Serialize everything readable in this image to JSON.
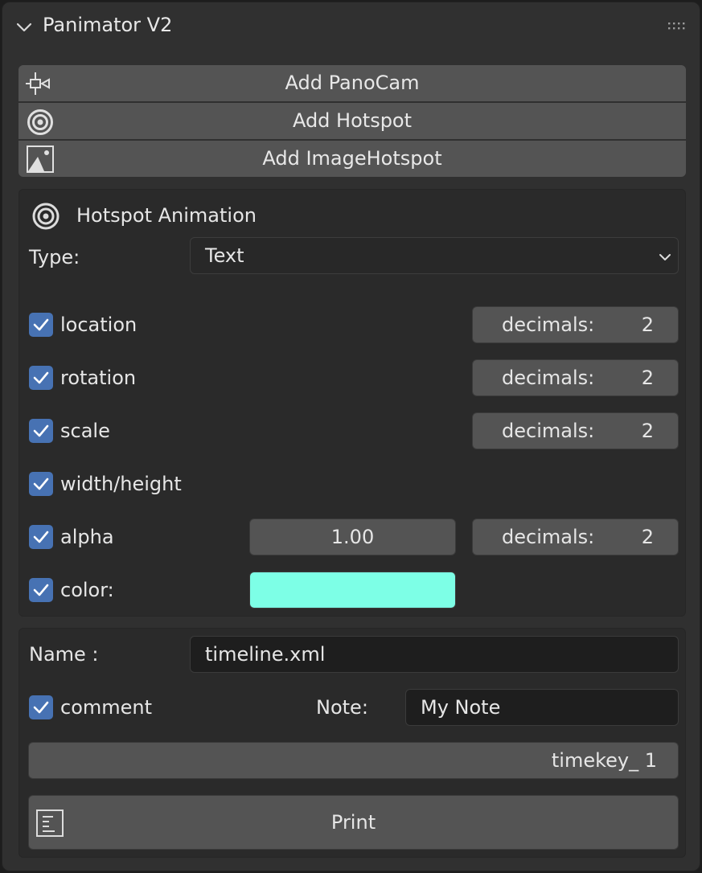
{
  "header": {
    "title": "Panimator V2"
  },
  "add_buttons": [
    {
      "label": "Add PanoCam",
      "icon": "camera-icon"
    },
    {
      "label": "Add Hotspot",
      "icon": "hotspot-icon"
    },
    {
      "label": "Add ImageHotspot",
      "icon": "image-icon"
    }
  ],
  "animation": {
    "heading": "Hotspot Animation",
    "type_label": "Type:",
    "type_value": "Text",
    "rows": {
      "location": {
        "label": "location",
        "checked": true,
        "decimals_label": "decimals:",
        "decimals": "2"
      },
      "rotation": {
        "label": "rotation",
        "checked": true,
        "decimals_label": "decimals:",
        "decimals": "2"
      },
      "scale": {
        "label": "scale",
        "checked": true,
        "decimals_label": "decimals:",
        "decimals": "2"
      },
      "width_height": {
        "label": "width/height",
        "checked": true
      },
      "alpha": {
        "label": "alpha",
        "checked": true,
        "value": "1.00",
        "decimals_label": "decimals:",
        "decimals": "2"
      },
      "color": {
        "label": "color:",
        "checked": true,
        "value_hex": "#7dffe6"
      }
    }
  },
  "output": {
    "name_label": "Name :",
    "name_value": "timeline.xml",
    "comment_label": "comment",
    "comment_checked": true,
    "note_label": "Note:",
    "note_value": "My Note",
    "timekey": "timekey_ 1",
    "print_label": "Print"
  },
  "colors": {
    "accent": "#4772b3",
    "panel": "#303030",
    "button": "#545454"
  }
}
